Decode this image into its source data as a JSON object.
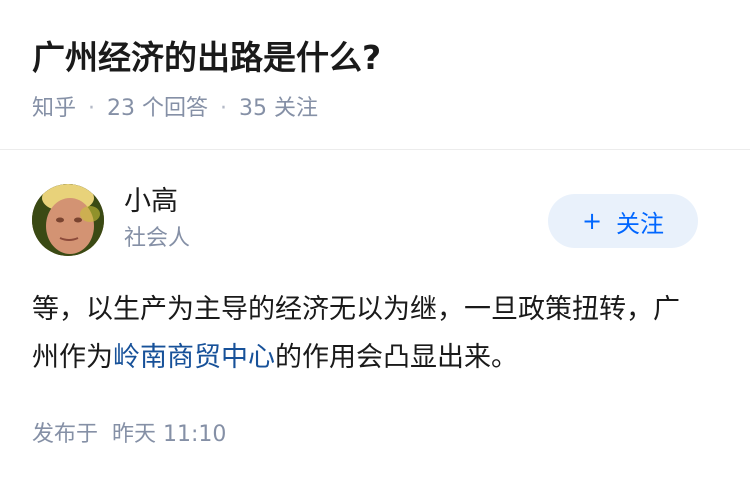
{
  "question": {
    "title": "广州经济的出路是什么?",
    "source": "知乎",
    "answer_count": "23 个回答",
    "follower_count": "35 关注"
  },
  "author": {
    "avatar_icon": "user-avatar-photo",
    "name": "小高",
    "bio": "社会人",
    "follow_plus": "+",
    "follow_label": "关注"
  },
  "answer": {
    "text_before": "等，以生产为主导的经济无以为继，一旦政策扭转，广州作为",
    "link_text": "岭南商贸中心",
    "text_after": "的作用会凸显出来。"
  },
  "footer": {
    "prefix": "发布于",
    "time": "昨天 11:10"
  },
  "colors": {
    "accent": "#0066ff",
    "link": "#175199",
    "meta": "#8590a6",
    "follow_bg": "#e9f1fb"
  }
}
